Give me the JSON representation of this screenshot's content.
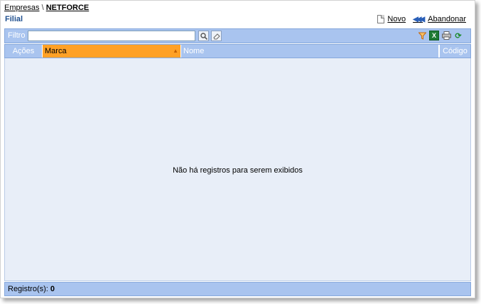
{
  "breadcrumb": {
    "parent": "Empresas",
    "separator": "\\",
    "current": "NETFORCE"
  },
  "page_title": "Filial",
  "actions": {
    "new_label": "Novo",
    "abandon_label": "Abandonar"
  },
  "toolbar": {
    "filter_label": "Filtro",
    "filter_value": "",
    "icons": [
      "search-icon",
      "eraser-icon",
      "filter-funnel-icon",
      "excel-export-icon",
      "print-icon",
      "refresh-icon"
    ]
  },
  "grid": {
    "columns": {
      "acoes": "Ações",
      "marca": "Marca",
      "nome": "Nome",
      "codigo": "Código"
    },
    "sorted_column": "Marca",
    "empty_message": "Não há registros para serem exibidos",
    "rows": []
  },
  "status": {
    "label": "Registro(s):",
    "count": "0"
  },
  "colors": {
    "header_bg": "#a9c4ef",
    "sorted_col_bg": "#ffa126",
    "body_bg": "#e8eef8",
    "title_color": "#1f4f8f"
  }
}
